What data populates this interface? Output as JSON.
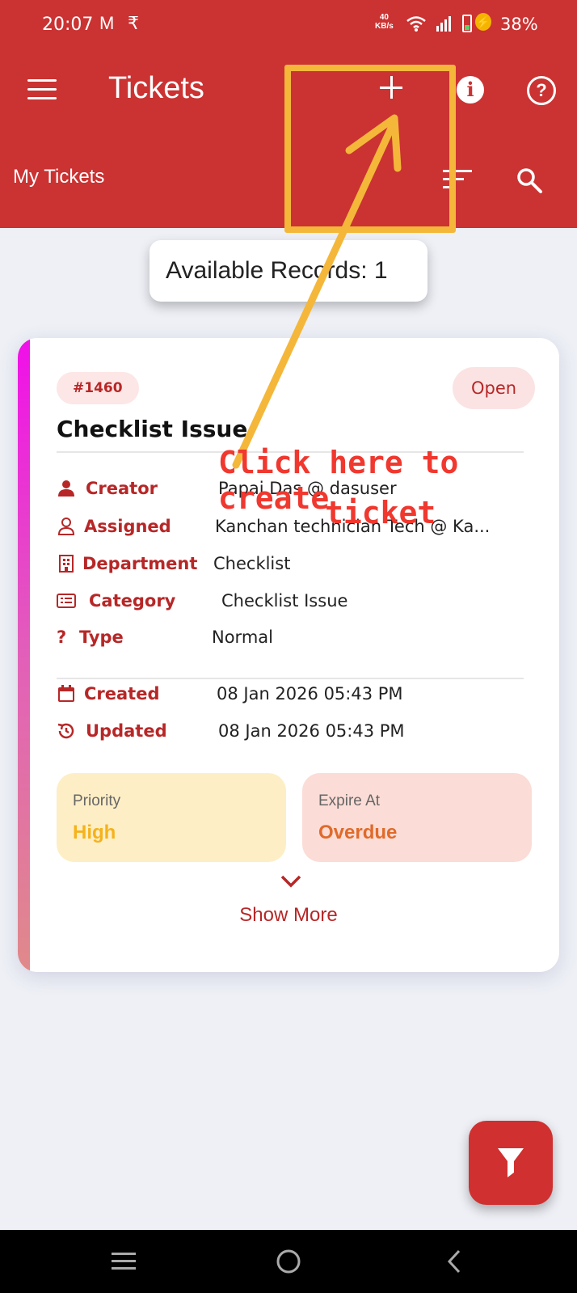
{
  "status_bar": {
    "time": "20:07",
    "mail_icon": "M",
    "rupee_icon": "₹",
    "net_speed_value": "40",
    "net_speed_unit": "KB/s",
    "battery": "38%"
  },
  "app_bar": {
    "title": "Tickets",
    "subtitle": "My Tickets",
    "info_icon": "i",
    "help_icon": "?",
    "color": "#cb3232"
  },
  "records_label": "Available Records: 1",
  "ticket": {
    "id": "#1460",
    "status": "Open",
    "title": "Checklist Issue",
    "rows": [
      {
        "label": "Creator",
        "value": "Papai Das @ dasuser"
      },
      {
        "label": "Assigned",
        "value": "Kanchan technician Tech @ Ka..."
      },
      {
        "label": "Department",
        "value": "Checklist"
      },
      {
        "label": "Category",
        "value": "Checklist Issue"
      },
      {
        "label": "Type",
        "value": "Normal"
      }
    ],
    "type_icon": "?",
    "dates": [
      {
        "label": "Created",
        "value": "08 Jan 2026 05:43 PM"
      },
      {
        "label": "Updated",
        "value": "08 Jan 2026 05:43 PM"
      }
    ],
    "priority": {
      "label": "Priority",
      "value": "High"
    },
    "expire": {
      "label": "Expire At",
      "value": "Overdue"
    },
    "show_more": "Show More"
  },
  "annotation": {
    "line1": "Click here to create",
    "line2": "ticket",
    "color": "#f0382f",
    "box_color": "#f4b73a"
  },
  "icons": [
    "menu-icon",
    "add-icon",
    "info-icon",
    "help-icon",
    "sort-icon",
    "search-icon",
    "filter-icon"
  ]
}
